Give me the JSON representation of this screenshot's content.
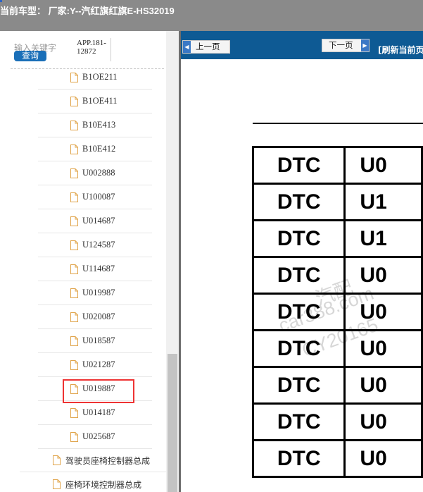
{
  "header": {
    "title": "当前车型：   厂家:Y--汽红旗红旗E-HS32019"
  },
  "sidebar": {
    "search_placeholder": "输入关键字",
    "search_button": "查询",
    "app_label": "APP.181-12872",
    "items": [
      "B1OE211",
      "B1OE411",
      "B10E413",
      "B10E412",
      "U002888",
      "U100087",
      "U014687",
      "U124587",
      "U114687",
      "U019987",
      "U020087",
      "U018587",
      "U021287",
      "U019887",
      "U014187",
      "U025687"
    ],
    "folders": [
      "驾驶员座椅控制器总成",
      "座椅环境控制器总成"
    ],
    "highlighted_item": "U019887"
  },
  "toolbar": {
    "prev_label": "上一页",
    "next_label": "下一页",
    "refresh_label": "[刷新当前页]"
  },
  "document": {
    "rows": [
      [
        "DTC",
        "U0"
      ],
      [
        "DTC",
        "U1"
      ],
      [
        "DTC",
        "U1"
      ],
      [
        "DTC",
        "U0"
      ],
      [
        "DTC",
        "U0"
      ],
      [
        "DTC",
        "U0"
      ],
      [
        "DTC",
        "U0"
      ],
      [
        "DTC",
        "U0"
      ],
      [
        "DTC",
        "U0"
      ]
    ],
    "watermark": [
      "汽配",
      "car388.com",
      "CY20165"
    ]
  },
  "colors": {
    "nav_blue": "#0e5a94",
    "header_gray": "#8a8a8a",
    "highlight_red": "#ee3333"
  }
}
